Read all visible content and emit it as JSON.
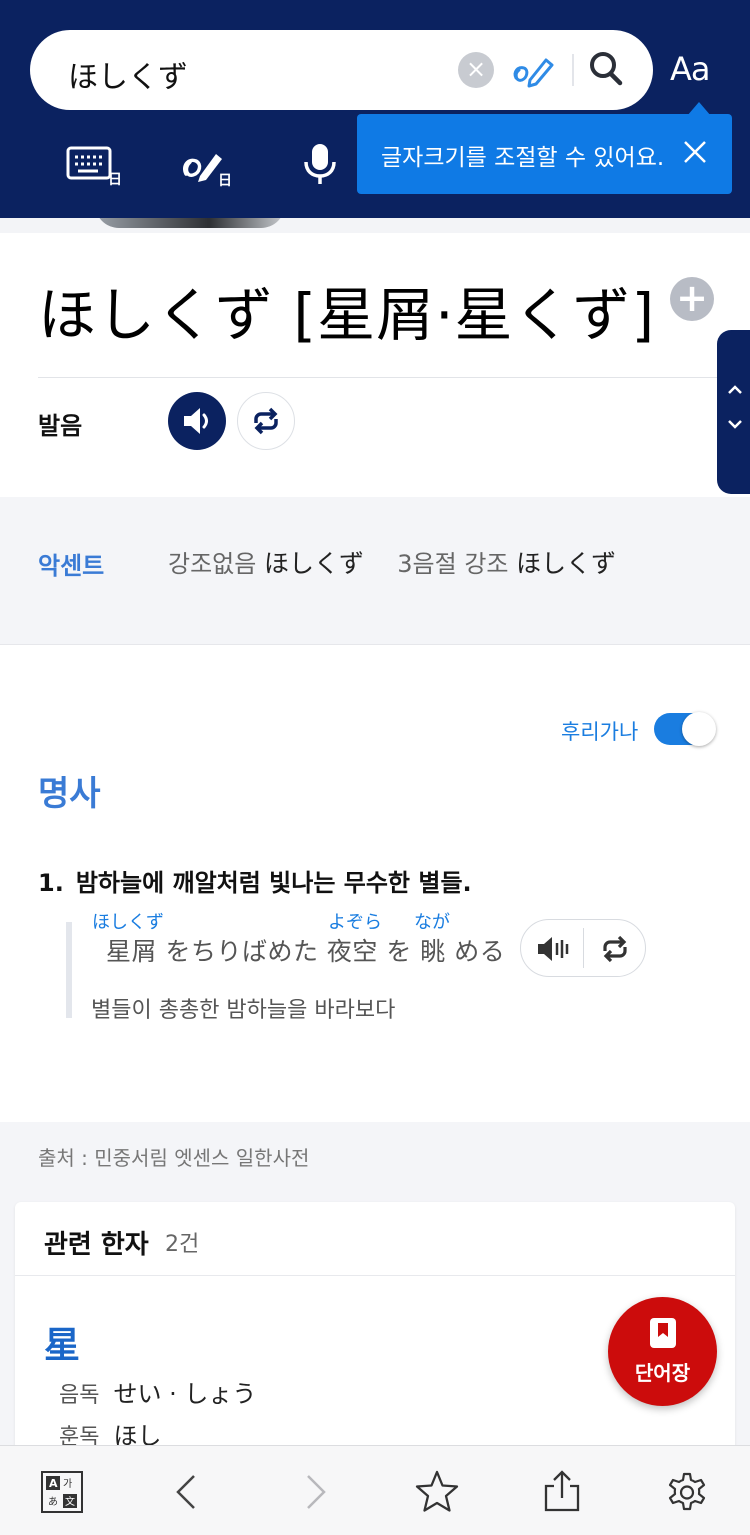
{
  "search": {
    "query": "ほしくず",
    "clear_symbol": "×",
    "font_size_label": "Aa"
  },
  "tooltip": {
    "text": "글자크기를 조절할 수 있어요."
  },
  "entry": {
    "title": "ほしくず [星屑·星くず]",
    "add_symbol": "+",
    "pronunciation_label": "발음"
  },
  "accent": {
    "label": "악센트",
    "items": [
      {
        "type": "강조없음",
        "kana": "ほしくず"
      },
      {
        "type": "3음절 강조",
        "kana": "ほしくず"
      }
    ]
  },
  "furigana": {
    "label": "후리가나",
    "enabled": true
  },
  "part_of_speech": "명사",
  "definition": {
    "number": "1.",
    "text": "밤하늘에 깨알처럼 빛나는 무수한 별들."
  },
  "example": {
    "furigana": [
      "ほしくず",
      "よぞら",
      "なが"
    ],
    "japanese": "星屑 をちりばめた 夜空 を 眺 める",
    "korean": "별들이 총총한 밤하늘을 바라보다"
  },
  "source": "출처 : 민중서림 엣센스 일한사전",
  "related_kanji": {
    "title": "관련 한자",
    "count": "2건",
    "items": [
      {
        "kanji": "星",
        "on_label": "음독",
        "on_reading": "せい · しょう",
        "kun_label": "훈독",
        "kun_reading": "ほし"
      }
    ]
  },
  "fab": {
    "label": "단어장"
  },
  "colors": {
    "header_navy": "#0b2260",
    "accent_blue": "#3a7bd5",
    "tooltip_blue": "#0f7ae5",
    "fab_red": "#cc0c0c"
  }
}
